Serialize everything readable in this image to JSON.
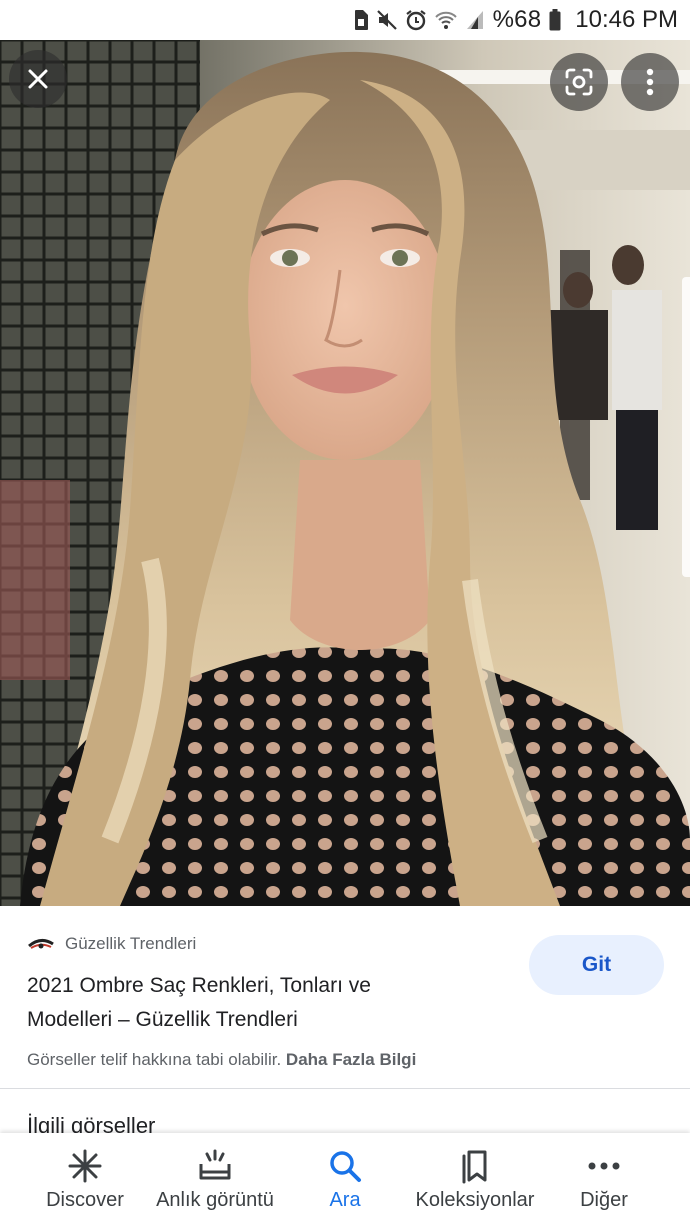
{
  "status_bar": {
    "battery": "%68",
    "time": "10:46 PM",
    "icons": [
      "sim-icon",
      "mute-icon",
      "alarm-icon",
      "wifi-icon",
      "signal-icon",
      "battery-icon"
    ]
  },
  "viewer": {
    "close_icon": "close-icon",
    "lens_icon": "google-lens-icon",
    "more_icon": "more-vert-icon"
  },
  "result": {
    "source_name": "Güzellik Trendleri",
    "title": "2021 Ombre Saç Renkleri, Tonları ve Modelleri – Güzellik Trendleri",
    "visit_label": "Git",
    "copyright_text": "Görseller telif hakkına tabi olabilir.",
    "learn_more": "Daha Fazla Bilgi",
    "related_heading": "İlgili görseller"
  },
  "bottom_nav": [
    {
      "label": "Discover",
      "icon": "discover-asterisk-icon"
    },
    {
      "label": "Anlık görüntü",
      "icon": "snapshot-icon"
    },
    {
      "label": "Ara",
      "icon": "search-icon"
    },
    {
      "label": "Koleksiyonlar",
      "icon": "collections-icon"
    },
    {
      "label": "Diğer",
      "icon": "more-horiz-icon"
    }
  ],
  "colors": {
    "accent": "#1a73e8",
    "visit_button_bg": "#e8f0fe",
    "secondary_text": "#5f6368"
  }
}
